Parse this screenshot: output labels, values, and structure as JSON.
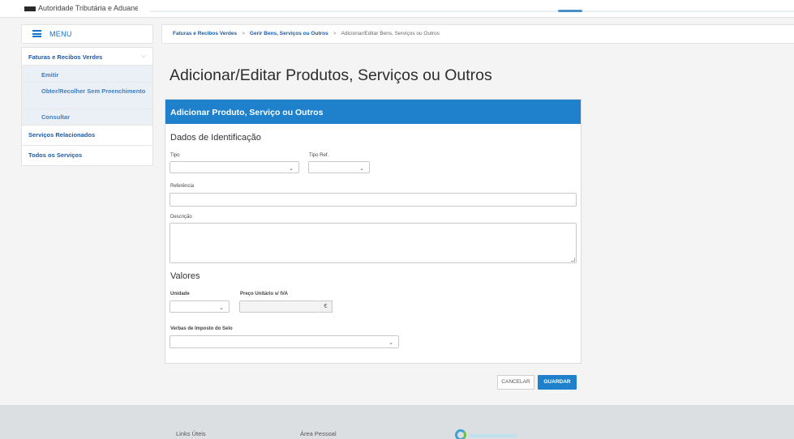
{
  "header": {
    "logo_text": "Autoridade Tributária e Aduaneira"
  },
  "menu": {
    "label": "MENU",
    "items": [
      {
        "label": "Faturas e Recibos Verdes",
        "expanded": true
      },
      {
        "label": "Emitir"
      },
      {
        "label": "Obter/Recolher Sem Preenchimento"
      },
      {
        "label": "Consultar"
      },
      {
        "label": "Serviços Relacionados"
      },
      {
        "label": "Todos os Serviços"
      }
    ]
  },
  "breadcrumb": {
    "items": [
      "Faturas e Recibos Verdes",
      "Gerir Bens, Serviços ou Outros",
      "Adicionar/Editar Bens, Serviços ou Outros"
    ],
    "separator": ">"
  },
  "page": {
    "title": "Adicionar/Editar Produtos, Serviços ou Outros"
  },
  "form": {
    "card_title": "Adicionar Produto, Serviço ou Outros",
    "identification_title": "Dados de Identificação",
    "tipo_label": "Tipo",
    "tipo_value": "",
    "tipo_ref_label": "Tipo Ref.",
    "tipo_ref_value": "",
    "referencia_label": "Referência",
    "referencia_value": "",
    "descricao_label": "Descrição",
    "descricao_value": "",
    "valores_title": "Valores",
    "unidade_label": "Unidade",
    "unidade_value": "",
    "preco_label": "Preço Unitário s/ IVA",
    "preco_value": "",
    "currency_symbol": "€",
    "imposto_label": "Verbas de Imposto do Selo",
    "imposto_value": ""
  },
  "actions": {
    "cancel_label": "CANCELAR",
    "save_label": "GUARDAR"
  },
  "footer": {
    "col1": "Links Úteis",
    "col2": "Área Pessoal"
  },
  "colors": {
    "accent": "#1f81cc",
    "link": "#1b5aa6",
    "submenu_bg": "#eaf0f5"
  }
}
